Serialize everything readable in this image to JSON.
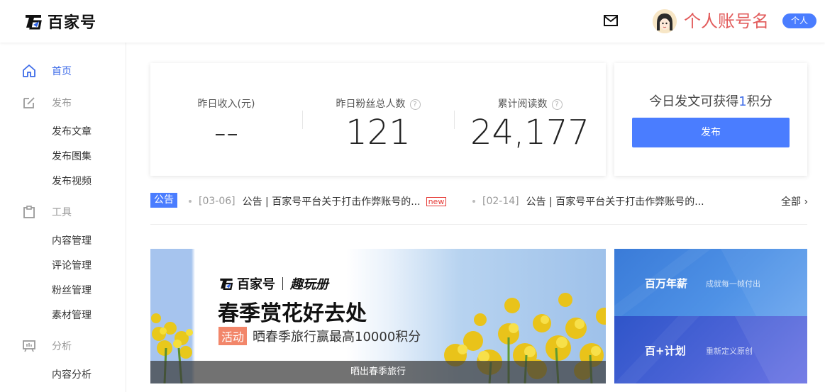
{
  "header": {
    "logo_text": "百家号",
    "account_name": "个人账号名",
    "account_type": "个人",
    "icons": {
      "mail": "mail-icon",
      "avatar": "avatar-image"
    }
  },
  "sidebar": {
    "groups": [
      {
        "label": "首页",
        "icon": "home-icon",
        "active": true,
        "items": []
      },
      {
        "label": "发布",
        "icon": "edit-icon",
        "active": false,
        "items": [
          "发布文章",
          "发布图集",
          "发布视频"
        ]
      },
      {
        "label": "工具",
        "icon": "clipboard-icon",
        "active": false,
        "items": [
          "内容管理",
          "评论管理",
          "粉丝管理",
          "素材管理"
        ]
      },
      {
        "label": "分析",
        "icon": "chart-board-icon",
        "active": false,
        "items": [
          "内容分析"
        ]
      }
    ]
  },
  "stats": {
    "income_label": "昨日收入(元)",
    "income_value": "--",
    "fans_label": "昨日粉丝总人数",
    "fans_value": "121",
    "reads_label": "累计阅读数",
    "reads_value": "24,177",
    "help_mark": "?"
  },
  "publish": {
    "tip_prefix": "今日发文可获得",
    "tip_number": "1",
    "tip_suffix": "积分",
    "button_label": "发布"
  },
  "notices": {
    "tag": "公告",
    "items": [
      {
        "date": "[03-06]",
        "text": "公告 | 百家号平台关于打击作弊账号的...",
        "badge": "new"
      },
      {
        "date": "[02-14]",
        "text": "公告 | 百家号平台关于打击作弊账号的..."
      }
    ],
    "all_link": "全部 ›"
  },
  "banner": {
    "logo_text": "百家号",
    "logo_sub": "趣玩册",
    "title": "春季赏花好去处",
    "activity_tag": "活动",
    "subtitle": "晒春季旅行赢最高10000积分",
    "footer": "晒出春季旅行"
  },
  "promos": [
    {
      "title": "百万年薪",
      "subtitle": "成就每一帧付出"
    },
    {
      "title": "百+计划",
      "subtitle": "重新定义原创"
    }
  ],
  "colors": {
    "accent": "#4a7dff",
    "nav_active": "#3d6be8",
    "name_red": "#e25c5c",
    "activity_orange": "#f2866a"
  }
}
